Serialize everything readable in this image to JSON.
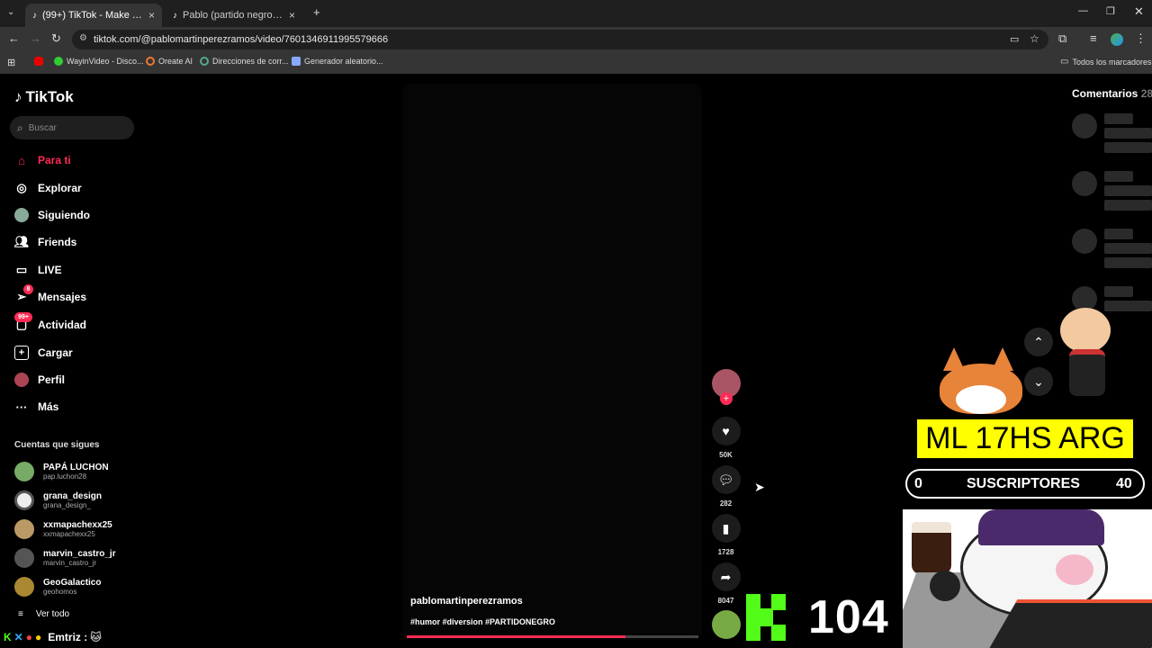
{
  "browser": {
    "tabs": [
      {
        "title": "(99+) TikTok - Make Your Day",
        "active": true
      },
      {
        "title": "Pablo (partido negro) (@pablo...",
        "active": false
      }
    ],
    "url": "tiktok.com/@pablomartinperezramos/video/7601346911995579666",
    "bookmarks": [
      "WayinVideo - Disco...",
      "Oreate AI",
      "Direcciones de corr...",
      "Generador aleatorio..."
    ],
    "all_bookmarks": "Todos los marcadores"
  },
  "sidebar": {
    "logo": "TikTok",
    "search_placeholder": "Buscar",
    "nav": [
      {
        "label": "Para ti",
        "icon": "home-icon"
      },
      {
        "label": "Explorar",
        "icon": "compass-icon"
      },
      {
        "label": "Siguiendo",
        "icon": "following-avatar-icon"
      },
      {
        "label": "Friends",
        "icon": "friends-icon"
      },
      {
        "label": "LIVE",
        "icon": "live-icon"
      },
      {
        "label": "Mensajes",
        "icon": "send-icon"
      },
      {
        "label": "Actividad",
        "icon": "inbox-icon"
      },
      {
        "label": "Cargar",
        "icon": "plus-square-icon"
      },
      {
        "label": "Perfil",
        "icon": "profile-avatar-icon"
      },
      {
        "label": "Más",
        "icon": "more-dots-icon"
      }
    ],
    "badges": {
      "messages": "8",
      "activity": "99+"
    },
    "following_title": "Cuentas que sigues",
    "following": [
      {
        "name": "PAPÁ LUCHON",
        "handle": "pap.luchon28"
      },
      {
        "name": "grana_design",
        "handle": "grana_design_"
      },
      {
        "name": "xxmapachexx25",
        "handle": "xxmapachexx25"
      },
      {
        "name": "marvin_castro_jr",
        "handle": "marvin_castro_jr"
      },
      {
        "name": "GeoGalactico",
        "handle": "geohomos"
      }
    ],
    "see_all": "Ver todo"
  },
  "video": {
    "author": "pablomartinperezramos",
    "hashtags": "#humor #diversion #PARTIDONEGRO",
    "progress": 0.75,
    "likes": "50K",
    "comments": "282",
    "saves": "1728",
    "shares": "8047"
  },
  "comments_panel": {
    "title": "Comentarios",
    "count": "28"
  },
  "overlay": {
    "banner": "ML 17HS ARG",
    "subs_left": "0",
    "subs_label": "SUSCRIPTORES",
    "subs_right": "40",
    "kick_count": "104",
    "chat_user": "Emtriz :"
  }
}
